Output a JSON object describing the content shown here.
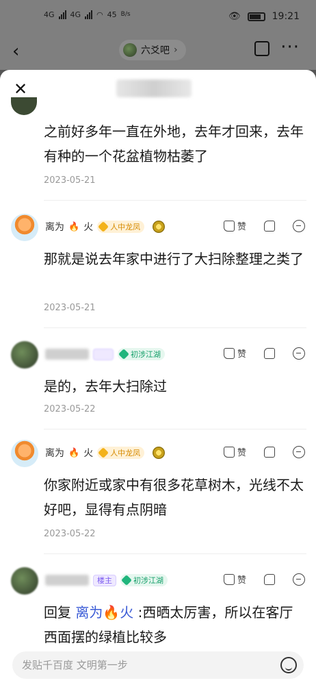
{
  "status": {
    "network_left": "4G",
    "network_right": "4G",
    "speed": "45",
    "speed_unit": "B/s",
    "time": "19:21"
  },
  "app_bar": {
    "forum_name": "六爻吧",
    "back_icon": "chevron-left-icon",
    "edit_icon": "edit-icon",
    "more_icon": "more-dots-icon"
  },
  "sheet": {
    "close_icon": "close-icon"
  },
  "top_comment": {
    "text": "之前好多年一直在外地，去年才回来，去年有种的一个花盆植物枯萎了",
    "date": "2023-05-21"
  },
  "comments": [
    {
      "user": "离为",
      "fire": "火",
      "level_badge": "人中龙凤",
      "text": "那就是说去年家中进行了大扫除整理之类了",
      "date": "2023-05-21",
      "like_label": "赞"
    },
    {
      "level_badge": "初涉江湖",
      "text": "是的，去年大扫除过",
      "date": "2023-05-22",
      "like_label": "赞"
    },
    {
      "user": "离为",
      "fire": "火",
      "level_badge": "人中龙凤",
      "text": "你家附近或家中有很多花草树木，光线不太好吧，显得有点阴暗",
      "date": "2023-05-22",
      "like_label": "赞"
    },
    {
      "owner_badge": "楼主",
      "level_badge": "初涉江湖",
      "reply_prefix": "回复",
      "reply_to": "离为🔥火",
      "text": ":西晒太厉害，所以在客厅西面摆的绿植比较多",
      "like_label": "赞"
    }
  ],
  "input": {
    "placeholder": "发贴千百度 文明第一步",
    "emoji_icon": "emoji-icon"
  }
}
